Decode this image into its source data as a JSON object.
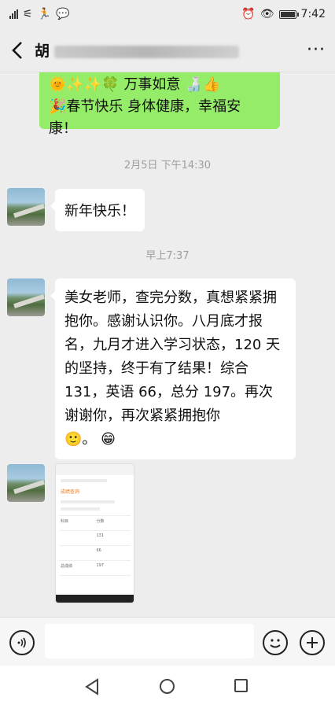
{
  "status_bar": {
    "time": "7:42",
    "left_icons": [
      "signal-icon",
      "wifi-off-icon",
      "running-person-icon",
      "wechat-icon"
    ],
    "right_icons": [
      "alarm-icon",
      "eye-icon",
      "battery-icon"
    ]
  },
  "header": {
    "title": "胡",
    "back_icon": "back-arrow-icon",
    "more_label": "···"
  },
  "messages": {
    "green_prev": {
      "line1": "万事如意",
      "line2": "春节快乐 身体健康，幸福安",
      "line3": "康！"
    },
    "ts1": "2月5日 下午14:30",
    "msg1": "新年快乐！",
    "ts2": "早上7:37",
    "msg2": "美女老师，查完分数，真想紧紧拥抱你。感谢认识你。八月底才报名，九月才进入学习状态，120 天的坚持，终于有了结果！综合 131，英语 66，总分 197。再次谢谢你，再次紧紧拥抱你",
    "msg2_tail": "。"
  },
  "screenshot_thumb": {
    "top_label": "成绩查询",
    "rows": [
      {
        "subject": "科目",
        "score": "分数"
      },
      {
        "subject": "",
        "score": "131"
      },
      {
        "subject": "",
        "score": "66"
      },
      {
        "subject": "总成绩",
        "score": "197"
      }
    ]
  },
  "input_bar": {
    "voice_icon": "voice-icon",
    "emoji_icon": "emoji-icon",
    "plus_icon": "plus-icon"
  },
  "android_nav": {
    "back_icon": "triangle-back-icon",
    "home_icon": "circle-home-icon",
    "recent_icon": "square-recent-icon"
  }
}
